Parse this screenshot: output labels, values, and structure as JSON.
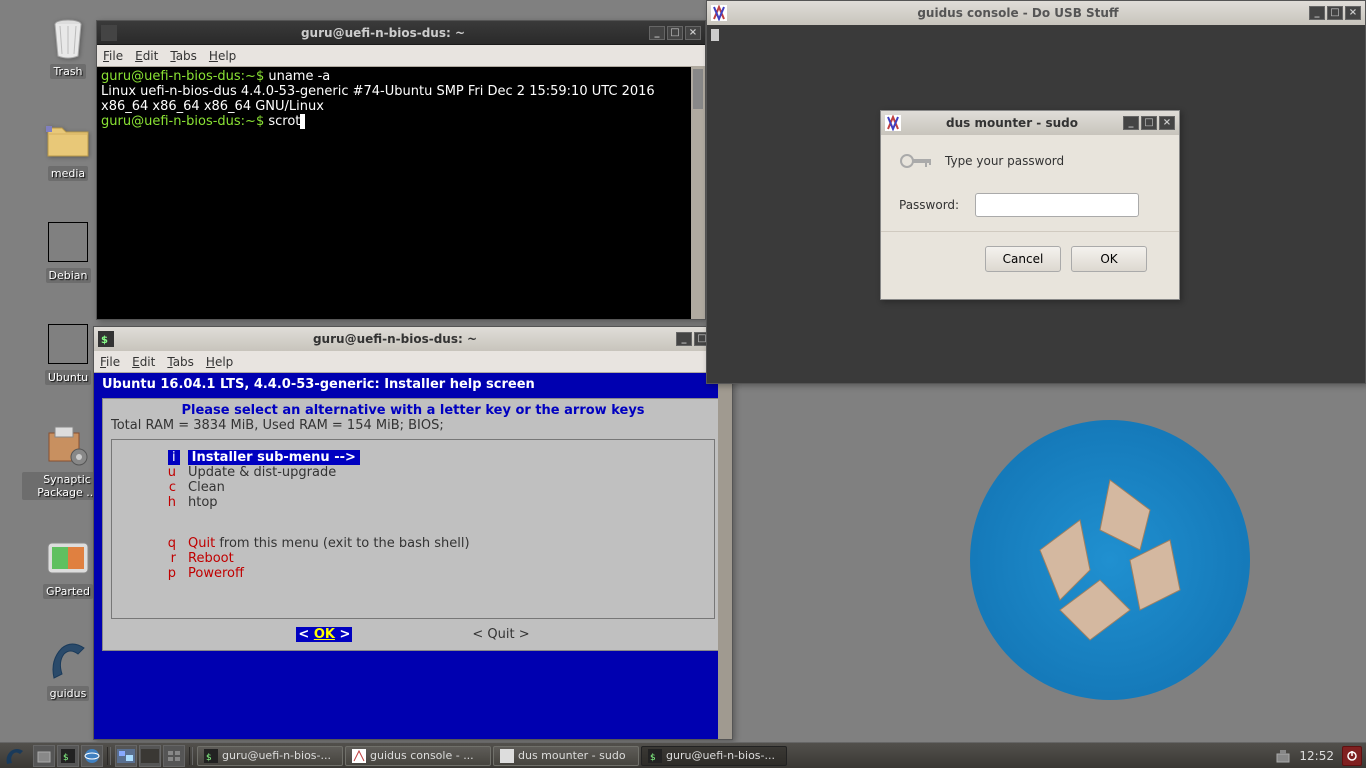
{
  "desktop": {
    "icons": [
      {
        "name": "trash",
        "label": "Trash"
      },
      {
        "name": "media",
        "label": "media"
      },
      {
        "name": "debian",
        "label": "Debian"
      },
      {
        "name": "ubuntu",
        "label": "Ubuntu"
      },
      {
        "name": "synaptic",
        "label": "Synaptic Package ..."
      },
      {
        "name": "gparted",
        "label": "GParted"
      },
      {
        "name": "guidus",
        "label": "guidus"
      }
    ]
  },
  "term1": {
    "title": "guru@uefi-n-bios-dus: ~",
    "menu": {
      "file": "File",
      "edit": "Edit",
      "tabs": "Tabs",
      "help": "Help"
    },
    "lines": {
      "l1a": "guru@uefi-n-bios-dus:~$ ",
      "l1b": "uname -a",
      "l2": "Linux uefi-n-bios-dus 4.4.0-53-generic #74-Ubuntu SMP Fri Dec 2 15:59:10 UTC 2016 x86_64 x86_64 x86_64 GNU/Linux",
      "l3a": "guru@uefi-n-bios-dus:~$ ",
      "l3b": "scrot"
    }
  },
  "guidus_console": {
    "title": "guidus console - Do USB Stuff"
  },
  "sudo": {
    "title": "dus mounter - sudo",
    "prompt": "Type your password",
    "label": "Password:",
    "cancel": "Cancel",
    "ok": "OK"
  },
  "term2": {
    "title": "guru@uefi-n-bios-dus: ~",
    "menu": {
      "file": "File",
      "edit": "Edit",
      "tabs": "Tabs",
      "help": "Help"
    },
    "header": "Ubuntu 16.04.1 LTS, 4.4.0-53-generic: Installer help screen",
    "select_prompt": "Please select an alternative with a letter key or the arrow keys",
    "ram": "Total RAM = 3834 MiB, Used RAM = 154 MiB; BIOS;",
    "items": {
      "i": {
        "key": "i",
        "txt": "Installer sub-menu -->"
      },
      "u": {
        "key": "u",
        "txt": "Update & dist-upgrade"
      },
      "c": {
        "key": "c",
        "txt": "Clean"
      },
      "h": {
        "key": "h",
        "txt": "htop"
      },
      "q": {
        "key": "q",
        "quit": "Quit",
        "rest": " from this menu (exit to the bash shell)"
      },
      "r": {
        "key": "r",
        "txt": "Reboot"
      },
      "p": {
        "key": "p",
        "txt": "Poweroff"
      }
    },
    "ok_btn": "OK",
    "quit_btn": "< Quit >"
  },
  "taskbar": {
    "tasks": [
      {
        "label": "guru@uefi-n-bios-..."
      },
      {
        "label": "guidus console - ..."
      },
      {
        "label": "dus mounter - sudo"
      },
      {
        "label": "guru@uefi-n-bios-..."
      }
    ],
    "clock": "12:52"
  }
}
